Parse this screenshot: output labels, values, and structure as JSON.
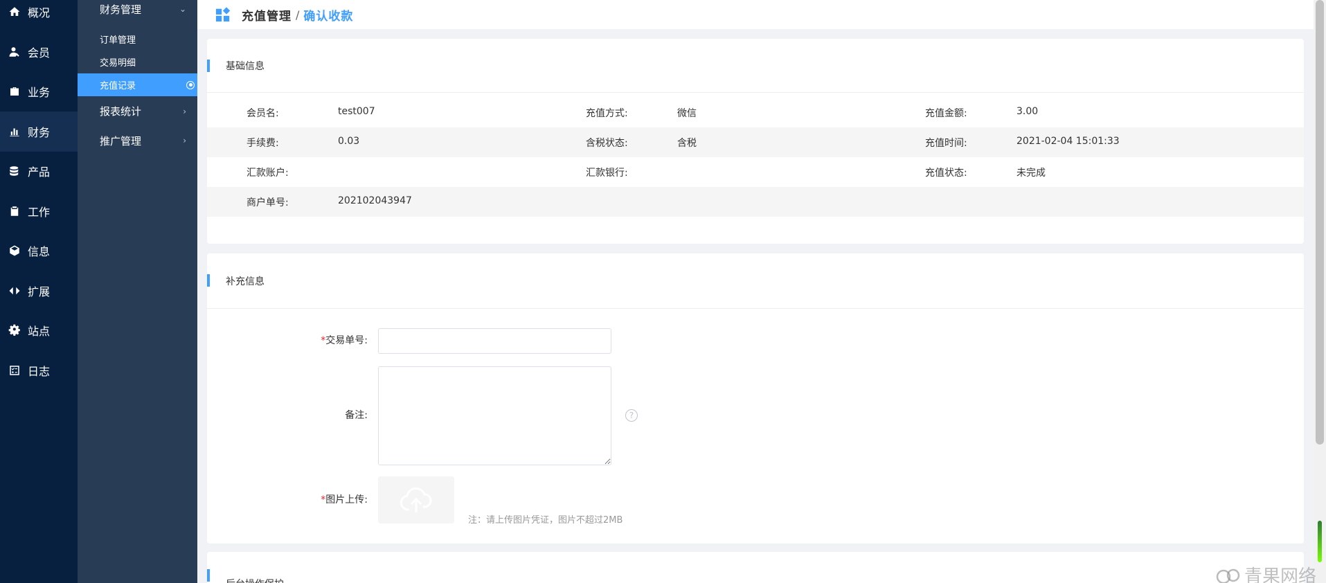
{
  "nav_primary": [
    {
      "label": "概况",
      "icon": "home-icon"
    },
    {
      "label": "会员",
      "icon": "user-icon"
    },
    {
      "label": "业务",
      "icon": "briefcase-icon"
    },
    {
      "label": "财务",
      "icon": "bar-chart-icon"
    },
    {
      "label": "产品",
      "icon": "database-icon"
    },
    {
      "label": "工作",
      "icon": "clipboard-icon"
    },
    {
      "label": "信息",
      "icon": "cube-icon"
    },
    {
      "label": "扩展",
      "icon": "expand-icon"
    },
    {
      "label": "站点",
      "icon": "gear-icon"
    },
    {
      "label": "日志",
      "icon": "checklist-icon"
    }
  ],
  "nav_secondary": {
    "group_finance": "财务管理",
    "items": [
      "订单管理",
      "交易明细",
      "充值记录"
    ],
    "group_report": "报表统计",
    "group_promo": "推广管理"
  },
  "breadcrumb": {
    "title": "充值管理",
    "separator": "/",
    "current": "确认收款"
  },
  "basic_info": {
    "title": "基础信息",
    "member_label": "会员名:",
    "member_value": "test007",
    "method_label": "充值方式:",
    "method_value": "微信",
    "amount_label": "充值金额:",
    "amount_value": "3.00",
    "fee_label": "手续费:",
    "fee_value": "0.03",
    "tax_label": "含税状态:",
    "tax_value": "含税",
    "time_label": "充值时间:",
    "time_value": "2021-02-04 15:01:33",
    "account_label": "汇款账户:",
    "account_value": "",
    "bank_label": "汇款银行:",
    "bank_value": "",
    "status_label": "充值状态:",
    "status_value": "未完成",
    "merchant_label": "商户单号:",
    "merchant_value": "202102043947"
  },
  "extra_info": {
    "title": "补充信息",
    "trade_no_label": "交易单号:",
    "trade_no_value": "",
    "remark_label": "备注:",
    "remark_value": "",
    "upload_label": "图片上传:",
    "upload_note": "注：请上传图片凭证，图片不超过2MB",
    "required_mark": "*",
    "help_glyph": "?"
  },
  "protect": {
    "title": "后台操作保护"
  },
  "watermark": "青果网络",
  "colors": {
    "accent": "#409eff",
    "danger": "#f5222d",
    "nav_primary_bg": "#08203f",
    "nav_secondary_bg": "#293c55"
  }
}
